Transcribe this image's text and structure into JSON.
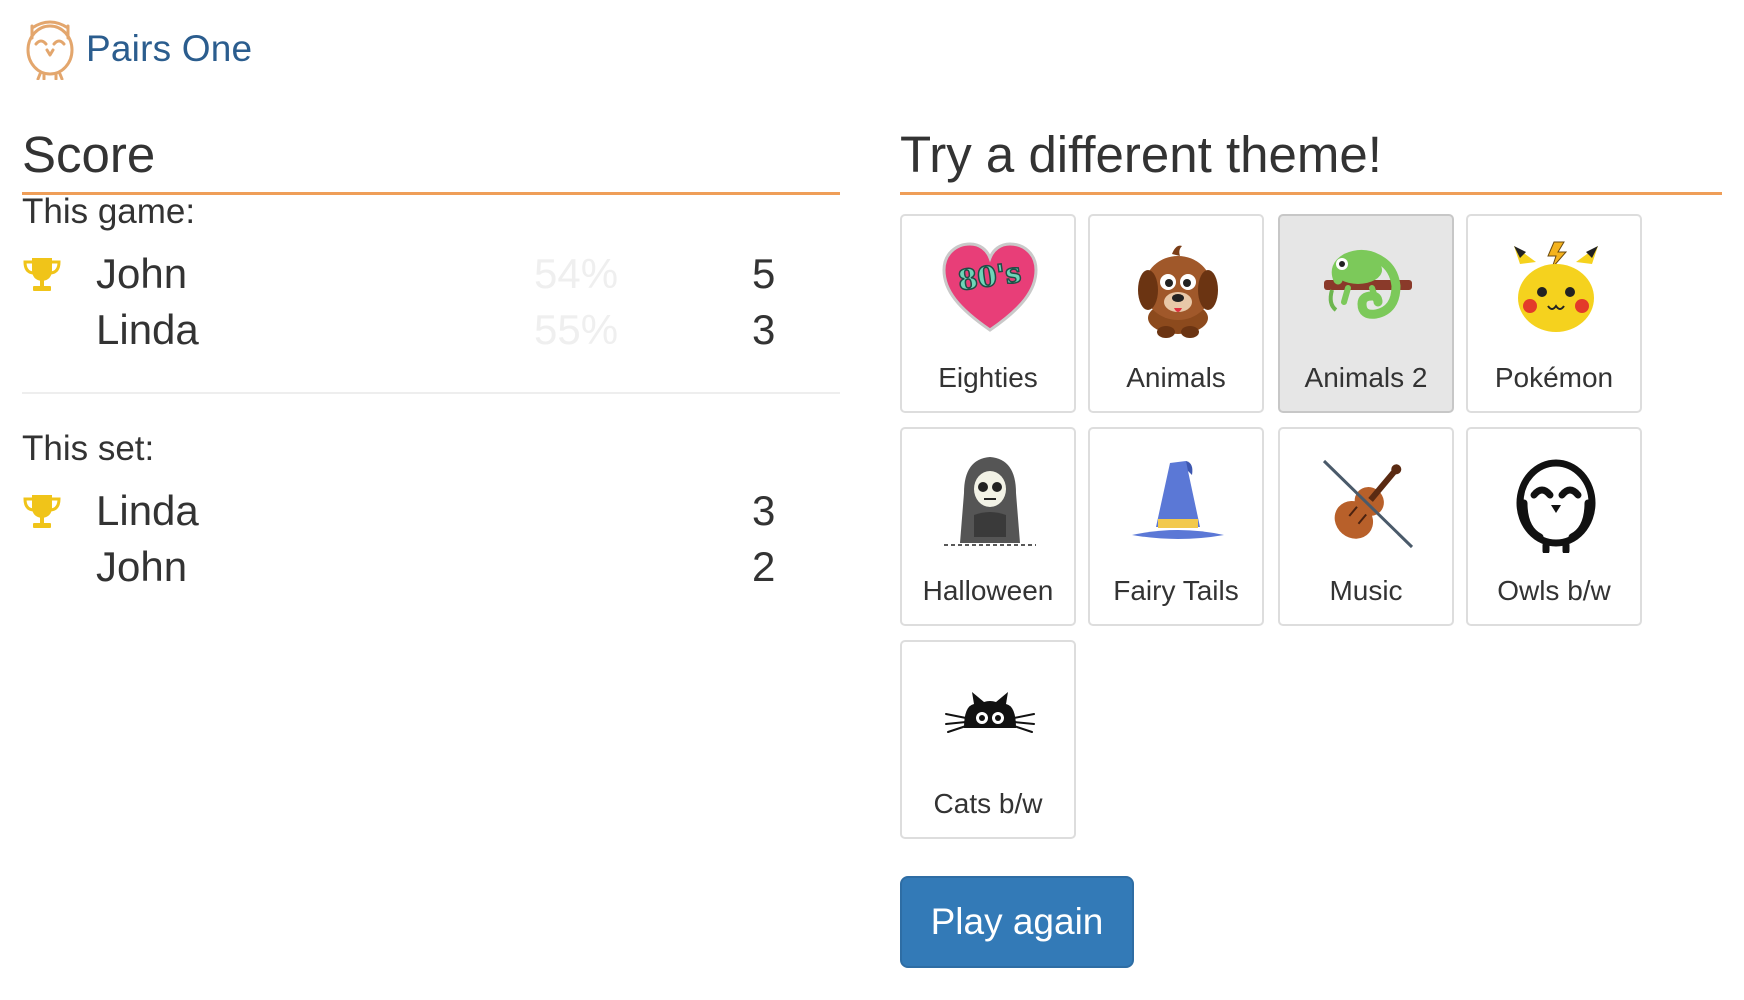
{
  "brand": {
    "name": "Pairs One",
    "logo_icon": "owl-logo-icon"
  },
  "score": {
    "title": "Score",
    "this_game": {
      "label": "This game:",
      "players": [
        {
          "name": "John",
          "percent": "54%",
          "score": "5",
          "winner": true
        },
        {
          "name": "Linda",
          "percent": "55%",
          "score": "3",
          "winner": false
        }
      ]
    },
    "this_set": {
      "label": "This set:",
      "players": [
        {
          "name": "Linda",
          "score": "3",
          "winner": true
        },
        {
          "name": "John",
          "score": "2",
          "winner": false
        }
      ]
    },
    "trophy_icon": "trophy-icon"
  },
  "themes": {
    "title": "Try a different theme!",
    "selected": "Animals 2",
    "items": [
      {
        "label": "Eighties",
        "icon": "eighties-heart-icon"
      },
      {
        "label": "Animals",
        "icon": "dog-icon"
      },
      {
        "label": "Animals 2",
        "icon": "chameleon-icon"
      },
      {
        "label": "Pokémon",
        "icon": "pikachu-icon"
      },
      {
        "label": "Halloween",
        "icon": "grim-reaper-icon"
      },
      {
        "label": "Fairy Tails",
        "icon": "wizard-hat-icon"
      },
      {
        "label": "Music",
        "icon": "violin-icon"
      },
      {
        "label": "Owls b/w",
        "icon": "owl-icon"
      },
      {
        "label": "Cats b/w",
        "icon": "cat-icon"
      }
    ],
    "icon_text": {
      "eighties": "80's"
    }
  },
  "actions": {
    "play_again": "Play again"
  },
  "colors": {
    "brand": "#2b5d8e",
    "accent_rule": "#ef9e58",
    "trophy": "#f0c419",
    "button": "#337ab7",
    "selected_tile": "#e6e6e6"
  }
}
